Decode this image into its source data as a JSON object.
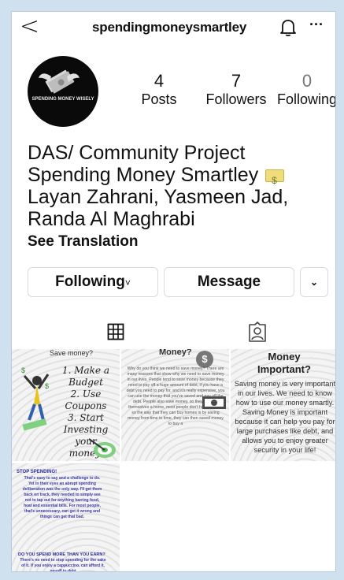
{
  "header": {
    "back_glyph": "<",
    "username": "spendingmoneysmartley",
    "more_glyph": "···"
  },
  "profile": {
    "avatar_text": "SPENDING MONEY WISELY",
    "stats": [
      {
        "count": "4",
        "label": "Posts"
      },
      {
        "count": "7",
        "label": "Followers"
      },
      {
        "count": "0",
        "label": "Following"
      }
    ]
  },
  "bio": {
    "line1": "DAS/ Community Project",
    "line2": "Spending Money Smartley",
    "line3": "Layan Zahrani, Yasmeen Jad,",
    "line4": "Randa Al Maghrabi",
    "see_translation": "See Translation"
  },
  "buttons": {
    "following": "Following",
    "following_chevron": "˅",
    "message": "Message",
    "dropdown": "⌄"
  },
  "tabs": {
    "grid_icon": "grid-icon",
    "tagged_icon": "tagged-person-icon"
  },
  "posts": [
    {
      "title": "Save money?",
      "list": [
        "1. Make a",
        "Budget",
        "2. Use Coupons",
        "3. Start",
        "Investing your",
        "money."
      ]
    },
    {
      "title": "Money?",
      "coin": "$",
      "text": "Why do you think we need to save money? There are many reasons that show why we need to save money in our lives. People tend to save money because they need to pay off a huge amount of debt, if you have a debt you need to pay for, and it's really expensive, you can use the money that you've saved and pay off the debt. People also save money, so they can buy themselves a home, most people don't have homes, so the way that they can buy homes is by saving money from time to time, they can then saved money to buy a"
    },
    {
      "title_line1": "Money",
      "title_line2": "Important?",
      "text": "Saving money is very important in our lives. We need to know how to use our money smartly. Saving Money is important because it can help you pay for large purchases like debt, and allows you to enjoy greater security in your life!"
    },
    {
      "head1": "STOP SPENDING!",
      "text1": "That's easy to say and a challenge to do. Yet in their eyes an abrupt spending deliberation was the only way. I'll get them back on track, they needed to simply see not to tap out for anything barring food, heat and essential bills. For most people, that's unnecessary, can get it wrong and things can get that bad.",
      "head2": "DO YOU SPEND MORE THAN YOU EARN?",
      "text2": "There's no need to stop spending for the sake of it. If you enjoy a cappuccino, can afford it, payoff to debt"
    }
  ],
  "colors": {
    "page_background": "#cfe0ee",
    "text": "#111111",
    "following_zero": "#777777",
    "post4_text": "#3a3aa8"
  }
}
